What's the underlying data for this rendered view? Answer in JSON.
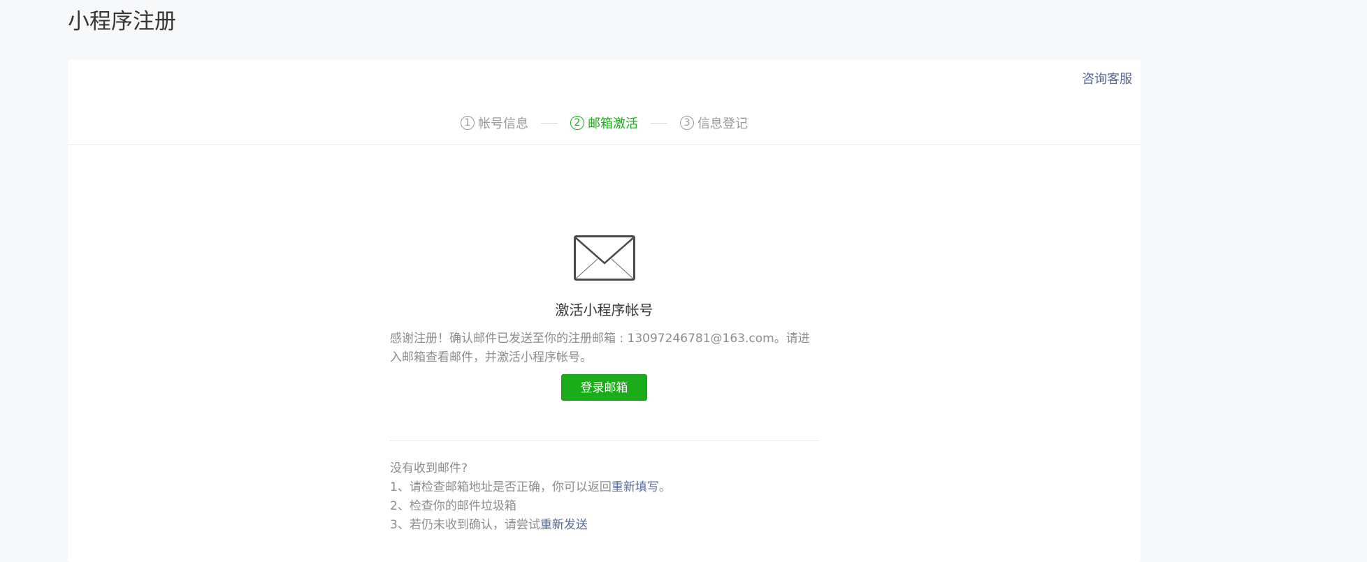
{
  "page": {
    "title": "小程序注册"
  },
  "header": {
    "consult_link": "咨询客服"
  },
  "steps": [
    {
      "num": "1",
      "label": "帐号信息",
      "state": "done"
    },
    {
      "num": "2",
      "label": "邮箱激活",
      "state": "active"
    },
    {
      "num": "3",
      "label": "信息登记",
      "state": "todo"
    }
  ],
  "colors": {
    "accent": "#1aad19",
    "link": "#576b95"
  },
  "activation": {
    "icon": "mail-envelope-icon",
    "title": "激活小程序帐号",
    "desc_prefix": "感谢注册！确认邮件已发送至你的注册邮箱 : ",
    "email": "13097246781@163.com",
    "desc_suffix": "。请进入邮箱查看邮件，并激活小程序帐号。",
    "login_button": "登录邮箱"
  },
  "help": {
    "heading": "没有收到邮件?",
    "item1_prefix": "1、请检查邮箱地址是否正确，你可以返回",
    "item1_link": "重新填写",
    "item1_suffix": "。",
    "item2": "2、检查你的邮件垃圾箱",
    "item3_prefix": "3、若仍未收到确认，请尝试",
    "item3_link": "重新发送"
  }
}
